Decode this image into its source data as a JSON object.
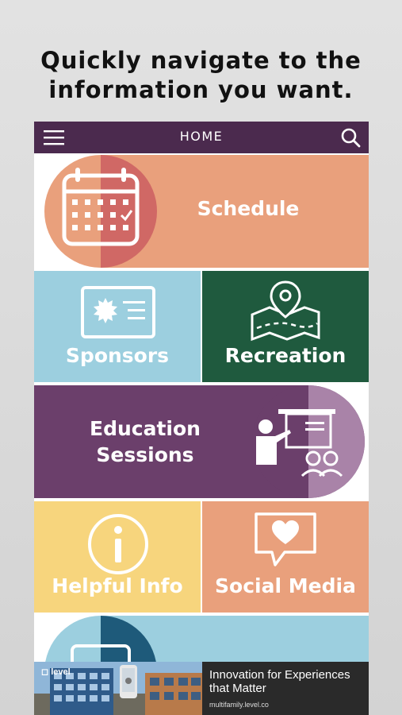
{
  "headline": {
    "line1": "Quickly navigate to the",
    "line2": "information you want."
  },
  "topbar": {
    "title": "HOME",
    "menu_icon": "hamburger-menu-icon",
    "search_icon": "search-icon"
  },
  "tiles": {
    "schedule": "Schedule",
    "sponsors": "Sponsors",
    "recreation": "Recreation",
    "education_line1": "Education",
    "education_line2": "Sessions",
    "helpful_info": "Helpful Info",
    "social_media": "Social Media"
  },
  "colors": {
    "header": "#4b2a4e",
    "schedule": "#e9a07c",
    "sponsors": "#9ccfdf",
    "recreation": "#1f5a3e",
    "education": "#6b3f6b",
    "helpful_info": "#f7d57d",
    "social_media": "#e9a07c",
    "partial_tile": "#9ccfdf"
  },
  "ad": {
    "logo_text": "level",
    "headline": "Innovation for Experiences that Matter",
    "url": "multifamily.level.co"
  }
}
